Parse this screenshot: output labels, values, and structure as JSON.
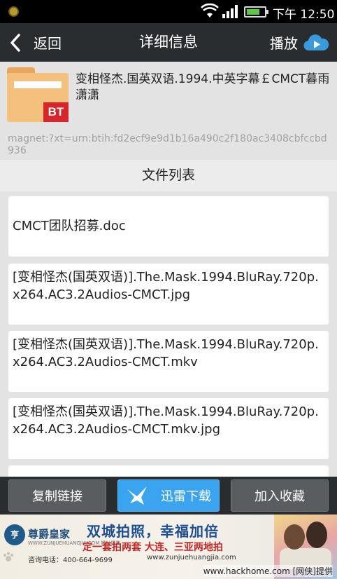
{
  "status_bar": {
    "time": "下午 12:50",
    "icons": [
      "notification-icon",
      "wifi-icon",
      "signal-icon",
      "battery-icon"
    ]
  },
  "header": {
    "back_label": "返回",
    "title": "详细信息",
    "play_label": "播放"
  },
  "torrent": {
    "badge": "BT",
    "name": "变相怪杰.国英双语.1994.中英字幕￡CMCT暮雨潇潇",
    "magnet": "magnet:?xt=urn:btih:fd2ecf9e9d1b16a490c2f180ac3408cbfccbd936"
  },
  "file_list": {
    "heading": "文件列表",
    "files": [
      "CMCT团队招募.doc",
      "[变相怪杰(国英双语)].The.Mask.1994.BluRay.720p.x264.AC3.2Audios-CMCT.jpg",
      "[变相怪杰(国英双语)].The.Mask.1994.BluRay.720p.x264.AC3.2Audios-CMCT.mkv",
      "[变相怪杰(国英双语)].The.Mask.1994.BluRay.720p.x264.AC3.2Audios-CMCT.mkv.jpg"
    ]
  },
  "actions": {
    "copy_link": "复制链接",
    "thunder_download": "迅雷下载",
    "add_favorite": "加入收藏"
  },
  "ad_banner": {
    "logo_mark": "亨",
    "brand": "尊爵皇家",
    "brand_sub": "WWW.ZUNJUEHUANGJIA.COM 婚纱摄影",
    "headline": "双城拍照，幸福加倍",
    "subline": "定一套拍两套  大连、三亚两地拍",
    "phone": "咨询电话：400-664-9699",
    "website": "www.zunjuehuangjia.com"
  },
  "watermark": "www.hackhome.com [网侠]提供",
  "colors": {
    "status_bar": "#000000",
    "title_bar": "#2a2d30",
    "background": "#e3e3e3",
    "primary_button": "#3ba4f0",
    "bt_badge": "#d6262a",
    "folder": "#f4c07d"
  }
}
